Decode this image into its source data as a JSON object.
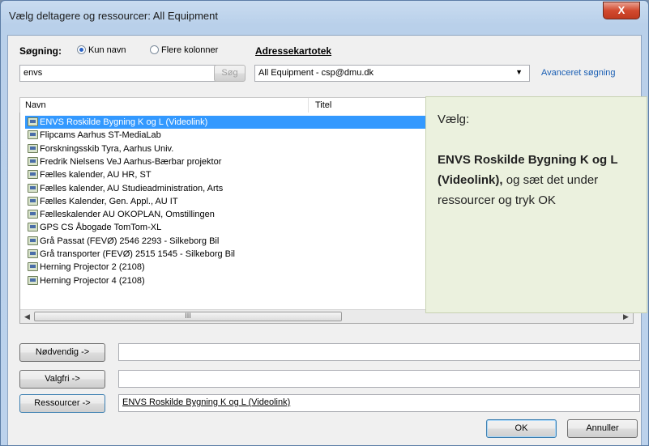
{
  "window": {
    "title": "Vælg deltagere og ressourcer: All Equipment",
    "close_label": "X"
  },
  "search": {
    "label": "Søgning:",
    "option_name_only": "Kun navn",
    "option_more_columns": "Flere kolonner",
    "selected_option": "Kun navn",
    "input_value": "envs",
    "search_button": "Søg"
  },
  "addressbook": {
    "label": "Adressekartotek",
    "selected": "All Equipment - csp@dmu.dk",
    "advanced_link": "Avanceret søgning"
  },
  "list": {
    "columns": [
      "Navn",
      "Titel"
    ],
    "rows": [
      "ENVS Roskilde Bygning K og L (Videolink)",
      "Flipcams Aarhus ST-MediaLab",
      "Forskningsskib Tyra, Aarhus Univ.",
      "Fredrik Nielsens VeJ Aarhus-Bærbar projektor",
      "Fælles kalender, AU HR, ST",
      "Fælles kalender, AU Studieadministration, Arts",
      "Fælles Kalender, Gen. Appl., AU IT",
      "Fælleskalender AU OKOPLAN, Omstillingen",
      "GPS CS  Åbogade TomTom-XL",
      "Grå Passat (FEVØ) 2546 2293 - Silkeborg Bil",
      "Grå transporter (FEVØ) 2515 1545 - Silkeborg Bil",
      "Herning Projector 2 (2108)",
      "Herning Projector 4 (2108)"
    ],
    "selected_index": 0,
    "scrollbar_thumb": "III"
  },
  "note": {
    "line1": "Vælg:",
    "bold": "ENVS Roskilde Bygning K og L (Videolink),",
    "rest": " og sæt det under ressourcer og tryk OK"
  },
  "recipients": {
    "required_button": "Nødvendig ->",
    "required_value": "",
    "optional_button": "Valgfri ->",
    "optional_value": "",
    "resources_button": "Ressourcer ->",
    "resources_value": "ENVS Roskilde Bygning K og L (Videolink)"
  },
  "footer": {
    "ok": "OK",
    "cancel": "Annuller"
  }
}
